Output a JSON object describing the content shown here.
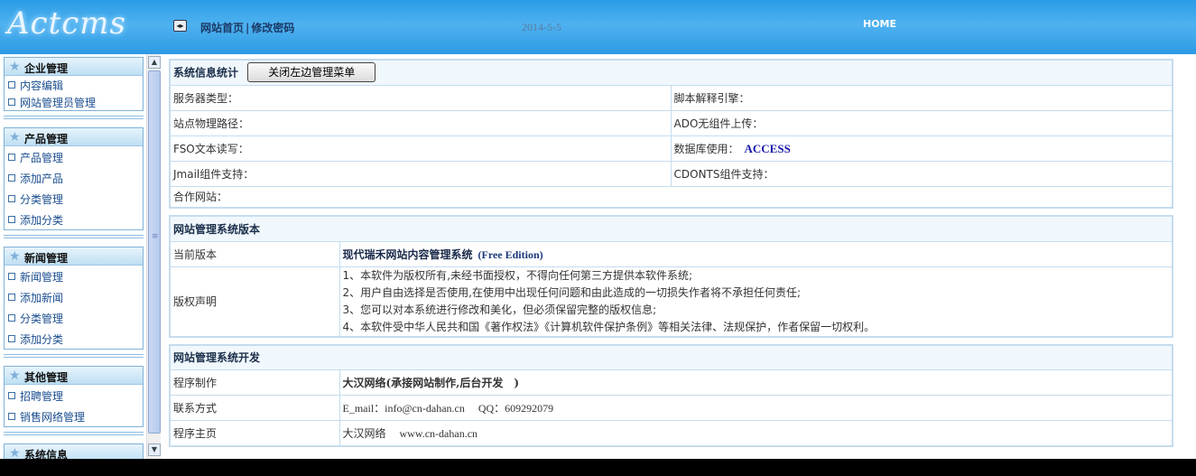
{
  "header": {
    "logo_text": "Actcms",
    "nav_icon": "◂▸",
    "nav_links": [
      "网站首页",
      "修改密码"
    ],
    "nav_separator": "|",
    "date": "2014-5-5",
    "home_label": "HOME"
  },
  "sidebar": {
    "groups": [
      {
        "title": "企业管理",
        "items": [
          "内容编辑",
          "网站管理员管理"
        ]
      },
      {
        "title": "产品管理",
        "items": [
          "产品管理",
          "添加产品",
          "分类管理",
          "添加分类"
        ]
      },
      {
        "title": "新闻管理",
        "items": [
          "新闻管理",
          "添加新闻",
          "分类管理",
          "添加分类"
        ]
      },
      {
        "title": "其他管理",
        "items": [
          "招聘管理",
          "销售网络管理"
        ]
      },
      {
        "title": "系统信息",
        "items": []
      }
    ],
    "scroll_up": "▲",
    "scroll_down": "▼",
    "scroll_grip": "≡"
  },
  "sysinfo": {
    "title": "系统信息统计",
    "toggle_button": "关闭左边管理菜单",
    "rows": [
      [
        "服务器类型：",
        "脚本解释引擎："
      ],
      [
        "站点物理路径：",
        "ADO无组件上传："
      ],
      [
        "FSO文本读写：",
        "数据库使用："
      ],
      [
        "Jmail组件支持：",
        "CDONTS组件支持："
      ]
    ],
    "db_value": "ACCESS",
    "partner_label": "合作网站："
  },
  "version": {
    "title": "网站管理系统版本",
    "current_label": "当前版本",
    "current_value": "现代瑞禾网站内容管理系统",
    "edition": "(Free Edition)",
    "copyright_label": "版权声明",
    "copyright_lines": [
      "1、本软件为版权所有,未经书面授权，不得向任何第三方提供本软件系统;",
      "2、用户自由选择是否使用,在使用中出现任何问题和由此造成的一切损失作者将不承担任何责任;",
      "3、您可以对本系统进行修改和美化，但必须保留完整的版权信息;",
      "4、本软件受中华人民共和国《著作权法》《计算机软件保护条例》等相关法律、法规保护，作者保留一切权利。"
    ]
  },
  "dev": {
    "title": "网站管理系统开发",
    "maker_label": "程序制作",
    "maker_value": "大汉网络(承接网站制作,后台开发　)",
    "contact_label": "联系方式",
    "contact_email": "E_mail：info@cn-dahan.cn",
    "contact_qq": "QQ：609292079",
    "homepage_label": "程序主页",
    "homepage_name": "大汉网络",
    "homepage_url": "www.cn-dahan.cn"
  }
}
